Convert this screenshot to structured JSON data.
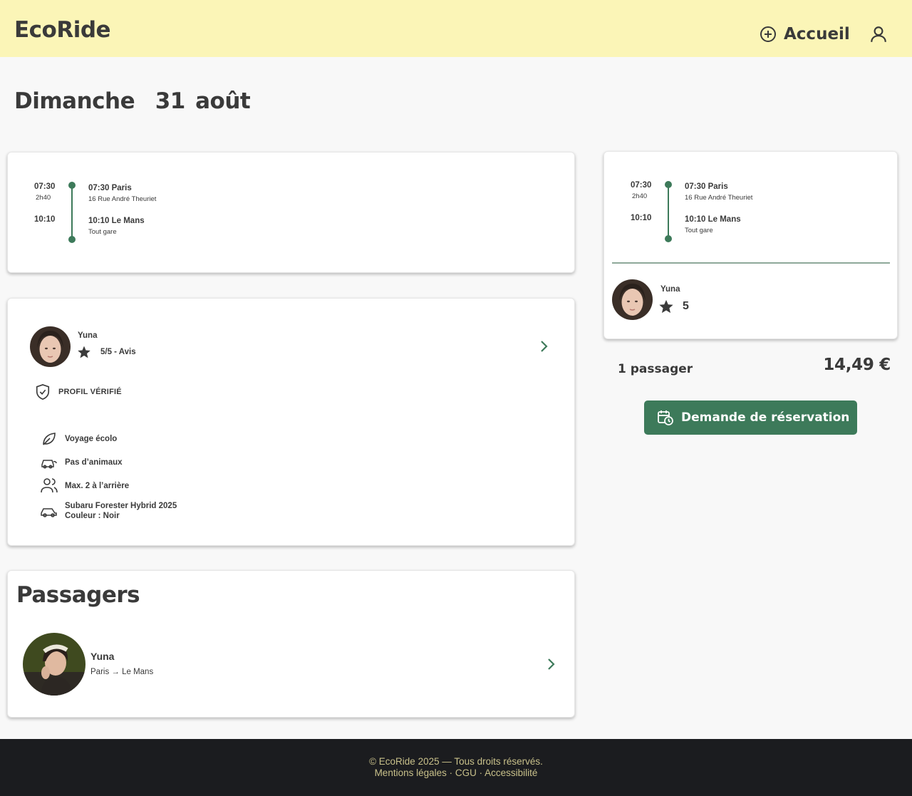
{
  "header": {
    "logo": "EcoRide",
    "home_label": "Accueil",
    "home_icon": "plus-circle-icon",
    "user_icon": "user-icon",
    "background": "#fbf5b7"
  },
  "page": {
    "title": "Dimanche  31 août"
  },
  "trip": {
    "depart_time": "07:30",
    "duration": "2h40",
    "arrive_time": "10:10",
    "depart_stop": "07:30 Paris",
    "depart_address": "16 Rue André Theuriet",
    "arrive_stop": "10:10 Le Mans",
    "arrive_address": "Tout gare",
    "accent": "#3d7a5a"
  },
  "driver": {
    "name": "Yuna",
    "rating_text": "5/5 - Avis",
    "rating_short": "5",
    "verified_label": "PROFIL VÉRIFIÉ",
    "features": [
      {
        "icon": "leaf-icon",
        "label": "Voyage écolo"
      },
      {
        "icon": "car-pet-icon",
        "label": "Pas d’animaux"
      },
      {
        "icon": "users-icon",
        "label": "Max. 2 à l’arrière"
      },
      {
        "icon": "car-icon",
        "label": "Subaru Forester Hybrid 2025",
        "label2": "Couleur : Noir"
      }
    ]
  },
  "passengers": {
    "title": "Passagers",
    "items": [
      {
        "name": "Yuna",
        "route": "Paris → Le Mans"
      }
    ]
  },
  "summary": {
    "passengers_count": "1 passager",
    "price": "14,49 €",
    "book_label": "Demande de réservation",
    "book_icon": "calendar-clock-icon"
  },
  "footer": {
    "copyright": "© EcoRide 2025 — Tous droits réservés.",
    "links": [
      "Mentions légales",
      "CGU",
      "Accessibilité"
    ],
    "separator": " · "
  }
}
